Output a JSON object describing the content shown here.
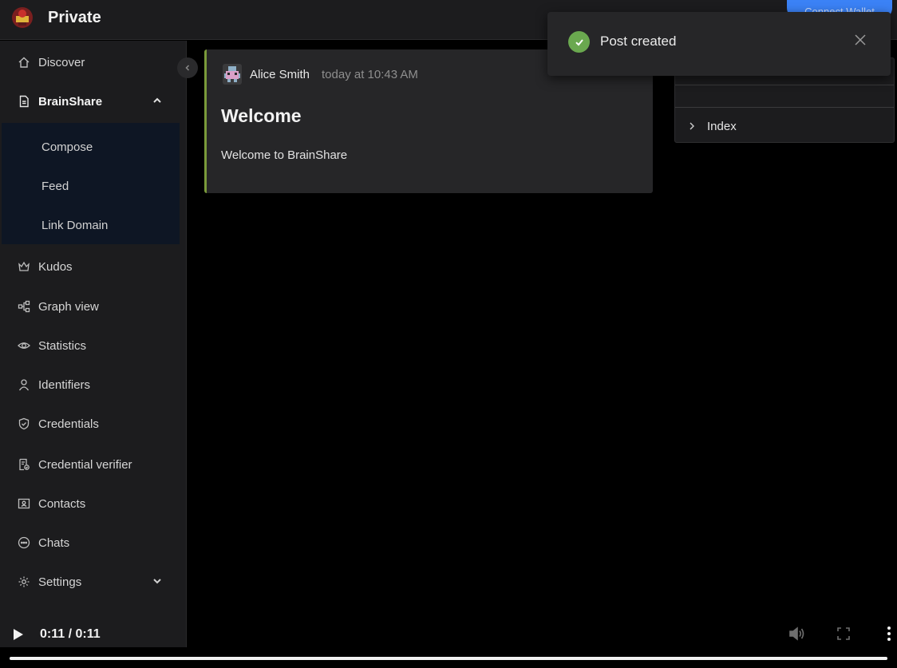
{
  "header": {
    "title": "Private",
    "connect_label": "Connect Wallet"
  },
  "sidebar": {
    "items": [
      {
        "label": "Discover",
        "icon": "home-icon"
      },
      {
        "label": "BrainShare",
        "icon": "document-icon"
      },
      {
        "label": "Kudos",
        "icon": "crown-icon"
      },
      {
        "label": "Graph view",
        "icon": "graph-icon"
      },
      {
        "label": "Statistics",
        "icon": "eye-icon"
      },
      {
        "label": "Identifiers",
        "icon": "user-icon"
      },
      {
        "label": "Credentials",
        "icon": "shield-check-icon"
      },
      {
        "label": "Credential verifier",
        "icon": "document-check-icon"
      },
      {
        "label": "Contacts",
        "icon": "contact-card-icon"
      },
      {
        "label": "Chats",
        "icon": "chat-icon"
      },
      {
        "label": "Settings",
        "icon": "gear-icon"
      }
    ],
    "submenu": [
      "Compose",
      "Feed",
      "Link Domain"
    ]
  },
  "post": {
    "author": "Alice Smith",
    "time": "today at 10:43 AM",
    "title": "Welcome",
    "body": "Welcome to BrainShare",
    "accent": "#7a9a3a"
  },
  "right_panel": {
    "index_label": "Index"
  },
  "toast": {
    "message": "Post created",
    "status_color": "#6aa84f"
  },
  "video": {
    "time": "0:11 / 0:11",
    "progress": 1.0
  }
}
